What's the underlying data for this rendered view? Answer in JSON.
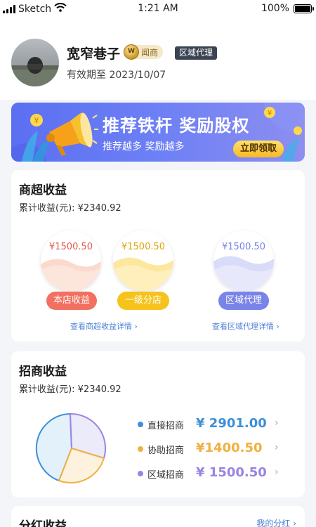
{
  "status_bar": {
    "carrier": "Sketch",
    "time": "1:21 AM",
    "battery": "100%"
  },
  "profile": {
    "name": "宽窄巷子",
    "vip_label": "闻商",
    "role": "区域代理",
    "expiry": "有效期至 2023/10/07"
  },
  "banner": {
    "title": "推荐铁杆 奖励股权",
    "subtitle": "推荐越多 奖励越多",
    "button": "立即领取"
  },
  "store_income": {
    "title": "商超收益",
    "total": "累计收益(元):  ¥2340.92",
    "items": [
      {
        "value": "¥1500.50",
        "label": "本店收益",
        "color": "#f27060",
        "fill_color": "#fbd9cd",
        "value_color": "#e35b50"
      },
      {
        "value": "¥1500.50",
        "label": "一级分店",
        "color": "#f6c21c",
        "fill_color": "#fde79f",
        "value_color": "#e1a50c"
      },
      {
        "value": "¥1500.50",
        "label": "区域代理",
        "color": "#7a83e8",
        "fill_color": "#d9dcf8",
        "value_color": "#7a83e8"
      }
    ],
    "links": [
      "查看商超收益详情 ›",
      "查看区域代理详情 ›"
    ]
  },
  "investment_income": {
    "title": "招商收益",
    "total": "累计收益(元):  ¥2340.92",
    "legend": [
      {
        "label": "直接招商",
        "value": "¥ 2901.00",
        "color": "#3d8fd6"
      },
      {
        "label": "协助招商",
        "value": "¥1400.50",
        "color": "#f0b040"
      },
      {
        "label": "区域招商",
        "value": "¥ 1500.50",
        "color": "#9b84e0"
      }
    ]
  },
  "dividend_income": {
    "title": "分红收益",
    "link": "我的分红 ›"
  }
}
